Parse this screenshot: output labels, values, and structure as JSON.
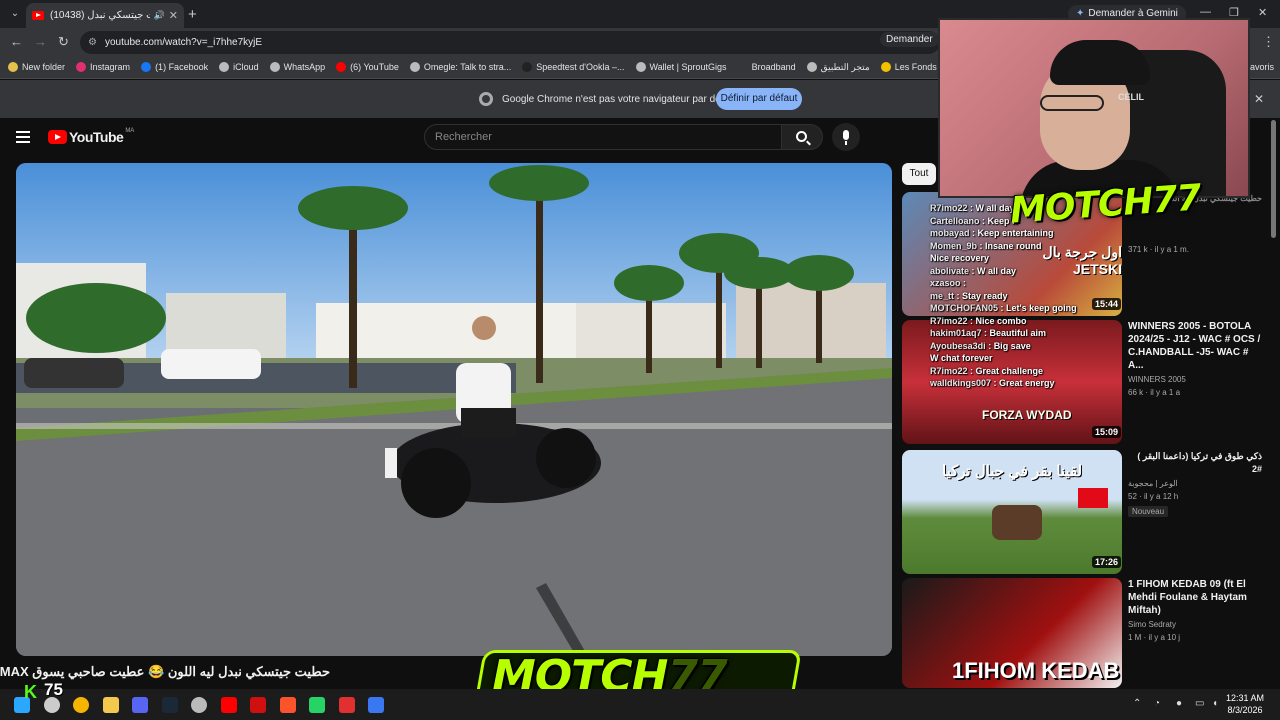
{
  "browser": {
    "tab_title": "حطيت جيتسكي نبدل (10438)",
    "gemini_label": "Demander à Gemini",
    "url": "youtube.com/watch?v=_i7hhe7kyjE",
    "omni_gemini_label": "Demander",
    "window_controls": {
      "minimize": "—",
      "restore": "❐",
      "close": "✕"
    }
  },
  "bookmarks": [
    {
      "label": "New folder",
      "color": "#e3c14a"
    },
    {
      "label": "Instagram",
      "color": "#e1306c"
    },
    {
      "label": "(1) Facebook",
      "color": "#1877f2"
    },
    {
      "label": "iCloud",
      "color": "#bbbbbb"
    },
    {
      "label": "WhatsApp",
      "color": "#bbbbbb"
    },
    {
      "label": "(6) YouTube",
      "color": "#ff0000"
    },
    {
      "label": "Omegle: Talk to stra...",
      "color": "#bbbbbb"
    },
    {
      "label": "Speedtest d'Ookla –...",
      "color": "#222222"
    },
    {
      "label": "Wallet | SproutGigs",
      "color": "#bbbbbb"
    },
    {
      "label": "Broadband",
      "color": "#35363a"
    },
    {
      "label": "متجر التطبيق",
      "color": "#bbbbbb"
    },
    {
      "label": "Les Fonds D'écran G...",
      "color": "#f2c200"
    },
    {
      "label": "Le",
      "color": "#f2c200"
    }
  ],
  "bookmarks_more": "avoris",
  "infobar": {
    "message": "Google Chrome n'est pas votre navigateur par défaut",
    "button": "Définir par défaut"
  },
  "youtube": {
    "logo_text": "YouTube",
    "region": "MA",
    "search_placeholder": "Rechercher",
    "video_title": "حطيت جيتسكي نبدل ليه اللون 😂 عطيت صاحبي يسوق TMAX 😂",
    "chip_all": "Tout"
  },
  "recommendations": [
    {
      "title": "حطيت جيتسكي نبدل ليه اللون",
      "channel": "",
      "views": "371 k",
      "age": "il y a 1 m.",
      "duration": "15:44",
      "thumb_text": "اول جرجة بال JETSKI"
    },
    {
      "title": "WINNERS 2005 - BOTOLA 2024/25 - J12 - WAC # OCS / C.HANDBALL -J5- WAC # A...",
      "channel": "WINNERS 2005",
      "views": "66 k",
      "age": "il y a 1 a",
      "duration": "15:09",
      "thumb_text": "FORZA WYDAD"
    },
    {
      "title": "ذكي طوق في تركيا (داعمنا البقر ) #2",
      "channel": "الوعر | محجوبة",
      "views": "52",
      "age": "il y a 12 h",
      "duration": "17:26",
      "badge": "Nouveau",
      "thumb_text": "لقينا بقر في جبال تركيا"
    },
    {
      "title": "1 FIHOM KEDAB 09 (ft El Mehdi Foulane & Haytam Miftah)",
      "channel": "Simo Sedraty",
      "views": "1 M",
      "age": "il y a 10 j",
      "duration": "",
      "thumb_text": "1FIHOM KEDAB"
    }
  ],
  "chat": [
    {
      "user": "R7imo22",
      "msg": "W all day"
    },
    {
      "user": "Cartelloano",
      "msg": "Keep it"
    },
    {
      "user": "mobayad",
      "msg": "Keep entertaining"
    },
    {
      "user": "Momen_9b",
      "msg": "Insane round"
    },
    {
      "user": "",
      "msg": "Nice recovery"
    },
    {
      "user": "abolivate",
      "msg": "W all day"
    },
    {
      "user": "xzasoo",
      "msg": ""
    },
    {
      "user": "me_tt",
      "msg": "Stay ready"
    },
    {
      "user": "MOTCHOFAN05",
      "msg": "Let's keep going"
    },
    {
      "user": "R7imo22",
      "msg": "Nice combo"
    },
    {
      "user": "hakim01aq7",
      "msg": "Beautiful aim"
    },
    {
      "user": "Ayoubesa3di",
      "msg": "Big save"
    },
    {
      "user": "",
      "msg": "W chat forever"
    },
    {
      "user": "R7imo22",
      "msg": "Great challenge"
    },
    {
      "user": "walldkings007",
      "msg": "Great energy"
    }
  ],
  "overlay": {
    "brand": "MOTCH",
    "brand_suffix": "77",
    "cap_text": "CELIL",
    "viewer_count": "75",
    "k_logo": "K"
  },
  "taskbar": {
    "time": "12:31 AM",
    "date": "8/3/2026",
    "apps": [
      "start",
      "search",
      "chrome",
      "files",
      "discord",
      "steam",
      "obs",
      "youtube",
      "redapp",
      "brave",
      "whatsapp",
      "adobe",
      "app"
    ]
  },
  "colors": {
    "accent": "#8ab4f8",
    "yt_red": "#ff0000",
    "brand_green": "#b7ff00",
    "kick_green": "#53fc18"
  }
}
